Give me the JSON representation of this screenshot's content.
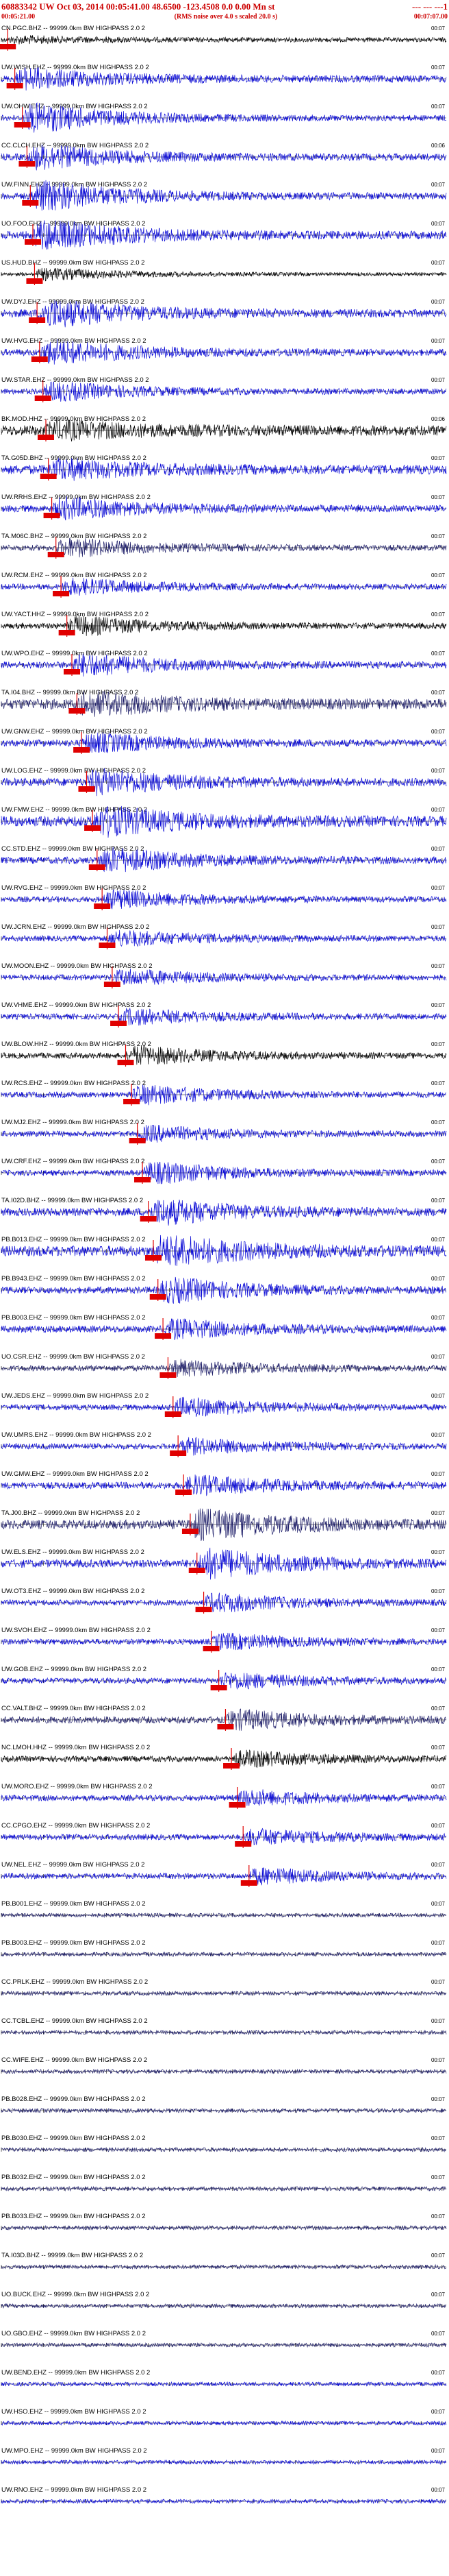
{
  "header": {
    "event_line": "60883342 UW Oct 03, 2014 00:05:41.00    48.6500  -123.4508  0.0 0.00 Mn st",
    "event_tail": "--- --- ---1",
    "start_time": "00:05:21.00",
    "noise_note": "(RMS noise over 4.0 s scaled 20.0 s)",
    "end_time": "00:07:07.00"
  },
  "colors": {
    "blue": "#0b0bd6",
    "navy": "#20206a",
    "black": "#000000",
    "pick": "#e00000",
    "header": "#cc0000"
  },
  "chart_data": {
    "type": "line",
    "title": "60883342 UW Oct 03, 2014 00:05:41.00    48.6500  -123.4508  0.0 0.00 Mn st",
    "x_range_s": [
      0,
      106
    ],
    "xlabel": "",
    "ylabel": "",
    "grid": false,
    "legend": "none",
    "filter_label": "HIGHPASS  2.0  2",
    "traces": [
      {
        "label": "CN.PGC.BHZ",
        "gain": "99999.0km BW",
        "tick": "00:07",
        "pick_s": 1.5,
        "amp": 0.4,
        "burst": 0.2,
        "color": "black"
      },
      {
        "label": "UW.WISH.EHZ",
        "gain": "99999.0km BW",
        "tick": "00:07",
        "pick_s": 3.2,
        "amp": 0.6,
        "burst": 0.7,
        "color": "blue"
      },
      {
        "label": "UW.OHW.EHZ",
        "gain": "99999.0km BW",
        "tick": "00:07",
        "pick_s": 5.0,
        "amp": 0.5,
        "burst": 1.0,
        "color": "blue"
      },
      {
        "label": "CC.CLCH.EHZ",
        "gain": "99999.0km BW",
        "tick": "00:06",
        "pick_s": 6.1,
        "amp": 0.6,
        "burst": 0.8,
        "color": "blue"
      },
      {
        "label": "UW.FINN.EHZ",
        "gain": "99999.0km BW",
        "tick": "00:07",
        "pick_s": 6.9,
        "amp": 0.6,
        "burst": 1.0,
        "color": "blue"
      },
      {
        "label": "UO.FOO.EHZ",
        "gain": "99999.0km BW",
        "tick": "00:07",
        "pick_s": 7.5,
        "amp": 0.7,
        "burst": 1.0,
        "color": "blue"
      },
      {
        "label": "US.HUD.BHZ",
        "gain": "99999.0km BW",
        "tick": "00:07",
        "pick_s": 7.9,
        "amp": 0.3,
        "burst": 0.4,
        "color": "black"
      },
      {
        "label": "UW.DYJ.EHZ",
        "gain": "99999.0km BW",
        "tick": "00:07",
        "pick_s": 8.5,
        "amp": 0.7,
        "burst": 0.9,
        "color": "blue"
      },
      {
        "label": "UW.HVG.EHZ",
        "gain": "99999.0km BW",
        "tick": "00:07",
        "pick_s": 9.1,
        "amp": 0.6,
        "burst": 0.8,
        "color": "blue"
      },
      {
        "label": "UW.STAR.EHZ",
        "gain": "99999.0km BW",
        "tick": "00:07",
        "pick_s": 9.9,
        "amp": 0.5,
        "burst": 0.6,
        "color": "blue"
      },
      {
        "label": "BK.MOD.HHZ",
        "gain": "99999.0km BW",
        "tick": "00:06",
        "pick_s": 10.6,
        "amp": 0.9,
        "burst": 0.5,
        "color": "black"
      },
      {
        "label": "TA.G05D.BHZ",
        "gain": "99999.0km BW",
        "tick": "00:07",
        "pick_s": 11.2,
        "amp": 0.8,
        "burst": 0.6,
        "color": "blue"
      },
      {
        "label": "UW.RRHS.EHZ",
        "gain": "99999.0km BW",
        "tick": "00:07",
        "pick_s": 12.0,
        "amp": 0.6,
        "burst": 0.7,
        "color": "blue"
      },
      {
        "label": "TA.M06C.BHZ",
        "gain": "99999.0km BW",
        "tick": "00:07",
        "pick_s": 13.0,
        "amp": 0.5,
        "burst": 0.6,
        "color": "navy"
      },
      {
        "label": "UW.RCM.EHZ",
        "gain": "99999.0km BW",
        "tick": "00:07",
        "pick_s": 14.2,
        "amp": 0.5,
        "burst": 0.5,
        "color": "blue"
      },
      {
        "label": "UW.YACT.HHZ",
        "gain": "99999.0km BW",
        "tick": "00:07",
        "pick_s": 15.6,
        "amp": 0.5,
        "burst": 0.6,
        "color": "black"
      },
      {
        "label": "UW.WPO.EHZ",
        "gain": "99999.0km BW",
        "tick": "00:07",
        "pick_s": 16.8,
        "amp": 0.6,
        "burst": 0.7,
        "color": "blue"
      },
      {
        "label": "TA.I04.BHZ",
        "gain": "99999.0km BW",
        "tick": "00:07",
        "pick_s": 18.0,
        "amp": 0.9,
        "burst": 0.7,
        "color": "navy"
      },
      {
        "label": "UW.GNW.EHZ",
        "gain": "99999.0km BW",
        "tick": "00:07",
        "pick_s": 19.1,
        "amp": 0.6,
        "burst": 0.6,
        "color": "blue"
      },
      {
        "label": "UW.LOG.EHZ",
        "gain": "99999.0km BW",
        "tick": "00:07",
        "pick_s": 20.3,
        "amp": 0.7,
        "burst": 0.8,
        "color": "blue"
      },
      {
        "label": "UW.FMW.EHZ",
        "gain": "99999.0km BW",
        "tick": "00:07",
        "pick_s": 21.7,
        "amp": 0.9,
        "burst": 0.9,
        "color": "blue"
      },
      {
        "label": "CC.STD.EHZ",
        "gain": "99999.0km BW",
        "tick": "00:07",
        "pick_s": 22.8,
        "amp": 0.6,
        "burst": 0.8,
        "color": "blue"
      },
      {
        "label": "UW.RVG.EHZ",
        "gain": "99999.0km BW",
        "tick": "00:07",
        "pick_s": 24.0,
        "amp": 0.5,
        "burst": 0.6,
        "color": "blue"
      },
      {
        "label": "UW.JCRN.EHZ",
        "gain": "99999.0km BW",
        "tick": "00:07",
        "pick_s": 25.2,
        "amp": 0.5,
        "burst": 0.5,
        "color": "blue"
      },
      {
        "label": "UW.MOON.EHZ",
        "gain": "99999.0km BW",
        "tick": "00:07",
        "pick_s": 26.4,
        "amp": 0.5,
        "burst": 0.5,
        "color": "blue"
      },
      {
        "label": "UW.VHME.EHZ",
        "gain": "99999.0km BW",
        "tick": "00:07",
        "pick_s": 27.9,
        "amp": 0.5,
        "burst": 0.5,
        "color": "blue"
      },
      {
        "label": "UW.BLOW.HHZ",
        "gain": "99999.0km BW",
        "tick": "00:07",
        "pick_s": 29.6,
        "amp": 0.5,
        "burst": 0.6,
        "color": "black"
      },
      {
        "label": "UW.RCS.EHZ",
        "gain": "99999.0km BW",
        "tick": "00:07",
        "pick_s": 31.0,
        "amp": 0.5,
        "burst": 0.6,
        "color": "blue"
      },
      {
        "label": "UW.MJ2.EHZ",
        "gain": "99999.0km BW",
        "tick": "00:07",
        "pick_s": 32.4,
        "amp": 0.5,
        "burst": 0.5,
        "color": "blue"
      },
      {
        "label": "UW.CRF.EHZ",
        "gain": "99999.0km BW",
        "tick": "00:07",
        "pick_s": 33.6,
        "amp": 0.5,
        "burst": 0.7,
        "color": "blue"
      },
      {
        "label": "TA.I02D.BHZ",
        "gain": "99999.0km BW",
        "tick": "00:07",
        "pick_s": 35.0,
        "amp": 0.7,
        "burst": 0.8,
        "color": "blue"
      },
      {
        "label": "PB.B013.EHZ",
        "gain": "99999.0km BW",
        "tick": "00:07",
        "pick_s": 36.2,
        "amp": 0.9,
        "burst": 1.0,
        "color": "blue"
      },
      {
        "label": "PB.B943.EHZ",
        "gain": "99999.0km BW",
        "tick": "00:07",
        "pick_s": 37.3,
        "amp": 0.6,
        "burst": 0.8,
        "color": "blue"
      },
      {
        "label": "PB.B003.EHZ",
        "gain": "99999.0km BW",
        "tick": "00:07",
        "pick_s": 38.5,
        "amp": 0.6,
        "burst": 0.6,
        "color": "blue"
      },
      {
        "label": "UO.CSR.EHZ",
        "gain": "99999.0km BW",
        "tick": "00:07",
        "pick_s": 39.7,
        "amp": 0.5,
        "burst": 0.5,
        "color": "navy"
      },
      {
        "label": "UW.JEDS.EHZ",
        "gain": "99999.0km BW",
        "tick": "00:07",
        "pick_s": 40.9,
        "amp": 0.5,
        "burst": 0.6,
        "color": "blue"
      },
      {
        "label": "UW.UMRS.EHZ",
        "gain": "99999.0km BW",
        "tick": "00:07",
        "pick_s": 42.1,
        "amp": 0.5,
        "burst": 0.5,
        "color": "blue"
      },
      {
        "label": "UW.GMW.EHZ",
        "gain": "99999.0km BW",
        "tick": "00:07",
        "pick_s": 43.4,
        "amp": 0.6,
        "burst": 0.6,
        "color": "blue"
      },
      {
        "label": "TA.J00.BHZ",
        "gain": "99999.0km BW",
        "tick": "00:07",
        "pick_s": 45.0,
        "amp": 0.8,
        "burst": 1.0,
        "color": "navy"
      },
      {
        "label": "UW.ELS.EHZ",
        "gain": "99999.0km BW",
        "tick": "00:07",
        "pick_s": 46.6,
        "amp": 0.7,
        "burst": 1.0,
        "color": "blue"
      },
      {
        "label": "UW.OT3.EHZ",
        "gain": "99999.0km BW",
        "tick": "00:07",
        "pick_s": 48.2,
        "amp": 0.5,
        "burst": 0.6,
        "color": "blue"
      },
      {
        "label": "UW.SVOH.EHZ",
        "gain": "99999.0km BW",
        "tick": "00:07",
        "pick_s": 50.0,
        "amp": 0.5,
        "burst": 0.5,
        "color": "blue"
      },
      {
        "label": "UW.GOB.EHZ",
        "gain": "99999.0km BW",
        "tick": "00:07",
        "pick_s": 51.8,
        "amp": 0.5,
        "burst": 0.5,
        "color": "blue"
      },
      {
        "label": "CC.VALT.BHZ",
        "gain": "99999.0km BW",
        "tick": "00:07",
        "pick_s": 53.4,
        "amp": 0.6,
        "burst": 0.6,
        "color": "navy"
      },
      {
        "label": "NC.LMOH.HHZ",
        "gain": "99999.0km BW",
        "tick": "00:07",
        "pick_s": 54.8,
        "amp": 0.5,
        "burst": 0.5,
        "color": "black"
      },
      {
        "label": "UW.MORO.EHZ",
        "gain": "99999.0km BW",
        "tick": "00:07",
        "pick_s": 56.2,
        "amp": 0.5,
        "burst": 0.5,
        "color": "blue"
      },
      {
        "label": "CC.CPGO.EHZ",
        "gain": "99999.0km BW",
        "tick": "00:07",
        "pick_s": 57.6,
        "amp": 0.5,
        "burst": 0.5,
        "color": "blue"
      },
      {
        "label": "UW.NEL.EHZ",
        "gain": "99999.0km BW",
        "tick": "00:07",
        "pick_s": 59.0,
        "amp": 0.5,
        "burst": 0.5,
        "color": "blue"
      },
      {
        "label": "PB.B001.EHZ",
        "gain": "99999.0km BW",
        "tick": "00:07",
        "pick_s": null,
        "amp": 0.35,
        "burst": 0.0,
        "color": "navy"
      },
      {
        "label": "PB.B003.EHZ",
        "gain": "99999.0km BW",
        "tick": "00:07",
        "pick_s": null,
        "amp": 0.35,
        "burst": 0.0,
        "color": "navy"
      },
      {
        "label": "CC.PRLK.EHZ",
        "gain": "99999.0km BW",
        "tick": "00:07",
        "pick_s": null,
        "amp": 0.35,
        "burst": 0.0,
        "color": "navy"
      },
      {
        "label": "CC.TCBL.EHZ",
        "gain": "99999.0km BW",
        "tick": "00:07",
        "pick_s": null,
        "amp": 0.35,
        "burst": 0.0,
        "color": "navy"
      },
      {
        "label": "CC.WIFE.EHZ",
        "gain": "99999.0km BW",
        "tick": "00:07",
        "pick_s": null,
        "amp": 0.35,
        "burst": 0.0,
        "color": "navy"
      },
      {
        "label": "PB.B028.EHZ",
        "gain": "99999.0km BW",
        "tick": "00:07",
        "pick_s": null,
        "amp": 0.35,
        "burst": 0.0,
        "color": "navy"
      },
      {
        "label": "PB.B030.EHZ",
        "gain": "99999.0km BW",
        "tick": "00:07",
        "pick_s": null,
        "amp": 0.35,
        "burst": 0.0,
        "color": "navy"
      },
      {
        "label": "PB.B032.EHZ",
        "gain": "99999.0km BW",
        "tick": "00:07",
        "pick_s": null,
        "amp": 0.35,
        "burst": 0.0,
        "color": "navy"
      },
      {
        "label": "PB.B033.EHZ",
        "gain": "99999.0km BW",
        "tick": "00:07",
        "pick_s": null,
        "amp": 0.35,
        "burst": 0.0,
        "color": "navy"
      },
      {
        "label": "TA.I03D.BHZ",
        "gain": "99999.0km BW",
        "tick": "00:07",
        "pick_s": null,
        "amp": 0.35,
        "burst": 0.0,
        "color": "navy"
      },
      {
        "label": "UO.BUCK.EHZ",
        "gain": "99999.0km BW",
        "tick": "00:07",
        "pick_s": null,
        "amp": 0.35,
        "burst": 0.0,
        "color": "navy"
      },
      {
        "label": "UO.GBO.EHZ",
        "gain": "99999.0km BW",
        "tick": "00:07",
        "pick_s": null,
        "amp": 0.35,
        "burst": 0.0,
        "color": "navy"
      },
      {
        "label": "UW.BEND.EHZ",
        "gain": "99999.0km BW",
        "tick": "00:07",
        "pick_s": null,
        "amp": 0.35,
        "burst": 0.0,
        "color": "blue"
      },
      {
        "label": "UW.HSO.EHZ",
        "gain": "99999.0km BW",
        "tick": "00:07",
        "pick_s": null,
        "amp": 0.35,
        "burst": 0.0,
        "color": "blue"
      },
      {
        "label": "UW.MPO.EHZ",
        "gain": "99999.0km BW",
        "tick": "00:07",
        "pick_s": null,
        "amp": 0.35,
        "burst": 0.0,
        "color": "blue"
      },
      {
        "label": "UW.RNO.EHZ",
        "gain": "99999.0km BW",
        "tick": "00:07",
        "pick_s": null,
        "amp": 0.35,
        "burst": 0.0,
        "color": "blue"
      }
    ]
  }
}
